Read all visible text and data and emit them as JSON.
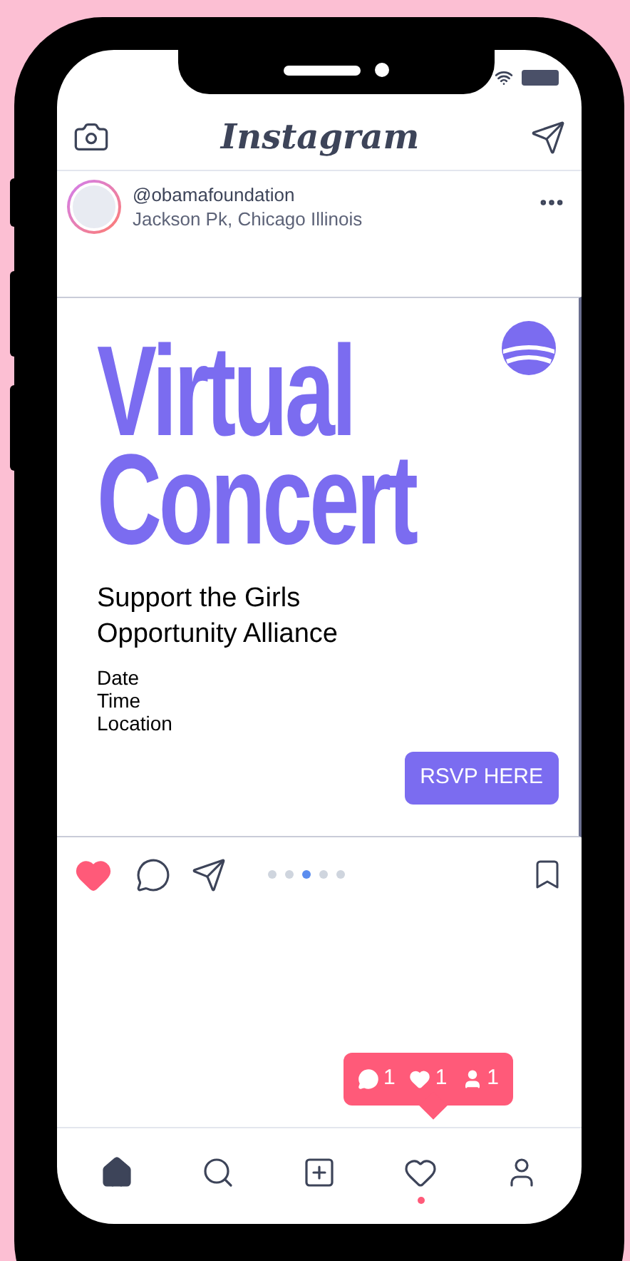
{
  "app": {
    "title": "Instagram"
  },
  "post": {
    "username": "@obamafoundation",
    "location": "Jackson Pk, Chicago Illinois",
    "headline": [
      "Virtual",
      "Concert"
    ],
    "subtitle": "Support the Girls Opportunity Alliance",
    "details": [
      "Date",
      "Time",
      "Location"
    ],
    "button": "RSVP HERE",
    "liked": true,
    "saved": false,
    "carousel": [
      {
        "selected": false
      },
      {
        "selected": false
      },
      {
        "selected": true
      },
      {
        "selected": false
      },
      {
        "selected": false
      }
    ]
  },
  "notification": {
    "items": [
      {
        "kind": "comment",
        "count": "1"
      },
      {
        "kind": "like",
        "count": "1"
      },
      {
        "kind": "follower",
        "count": "1"
      }
    ]
  },
  "nav": {
    "items": [
      {
        "kind": "home",
        "selected": true,
        "has_dot": false
      },
      {
        "kind": "search",
        "selected": false,
        "has_dot": false
      },
      {
        "kind": "add",
        "selected": false,
        "has_dot": false
      },
      {
        "kind": "activity",
        "selected": false,
        "has_dot": true
      },
      {
        "kind": "profile",
        "selected": false,
        "has_dot": false
      }
    ]
  }
}
